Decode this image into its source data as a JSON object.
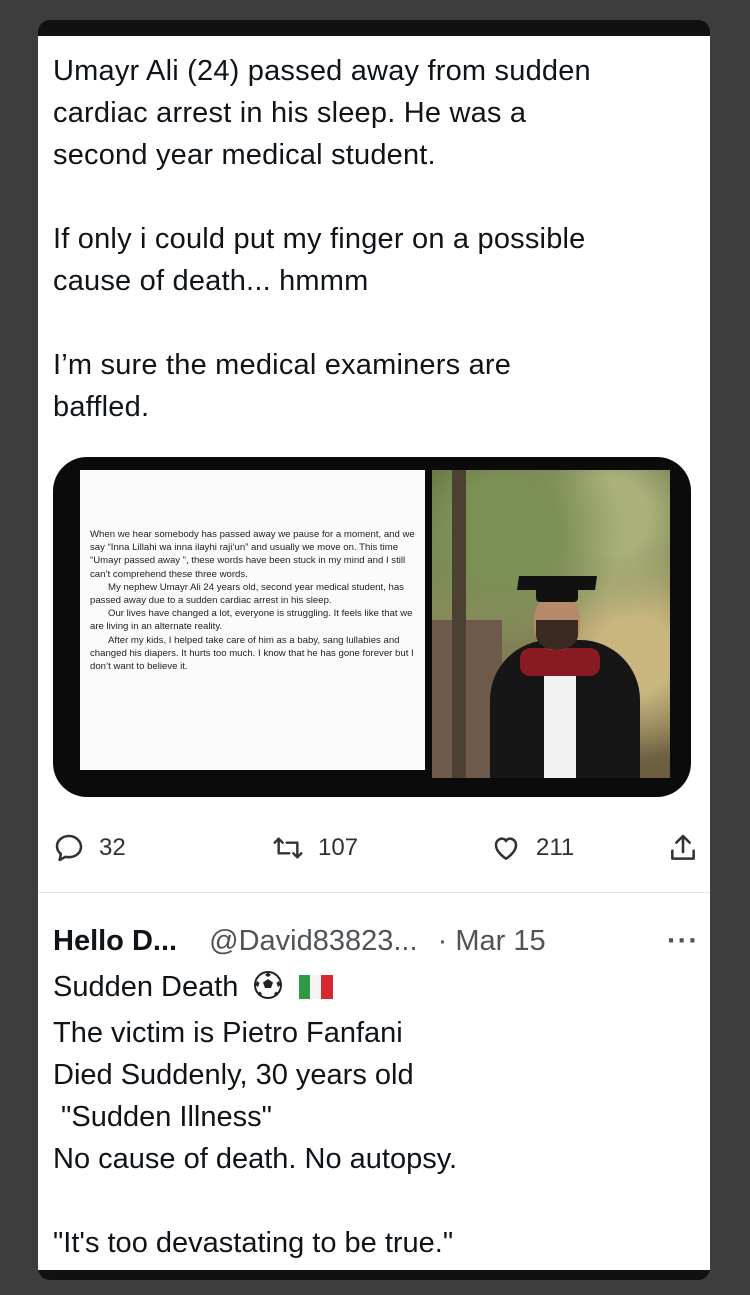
{
  "tweet": {
    "lines": [
      "Umayr Ali (24) passed away from sudden",
      "cardiac arrest in his sleep. He was a",
      "second year medical student.",
      "If only i could put my finger on a possible",
      "cause of death... hmmm",
      "I’m sure the medical examiners are",
      "baffled."
    ]
  },
  "media": {
    "letter": {
      "p1": "When we hear somebody has passed away we pause for a moment, and we say “Inna Lillahi wa inna ilayhi raji’un” and usually we move on. This time “Umayr passed away ”, these words have been stuck in my mind and I still can’t comprehend these three words.",
      "p2": "My nephew Umayr Ali 24 years old, second year medical student, has passed away due to a sudden cardiac arrest in his sleep.",
      "p3": "Our lives have changed a lot, everyone is struggling. It feels like that we are living in an alternate reality.",
      "p4": "After my kids, I helped take care of him as a baby, sang lullabies and changed his diapers. It hurts too much. I know that he has gone forever but I don’t want to believe it."
    }
  },
  "actions": {
    "reply_count": "32",
    "retweet_count": "107",
    "like_count": "211"
  },
  "reply": {
    "name": "Hello D...",
    "handle": "@David83823...",
    "date": "· Mar 15",
    "more": "···",
    "line1": "Sudden Death",
    "line2": "The victim is Pietro Fanfani",
    "line3": "Died Suddenly, 30 years old",
    "line4": " \"Sudden Illness\"",
    "line5": "No cause of death. No autopsy.",
    "line6": "\"It's too devastating to be true.\""
  },
  "colors": {
    "flag_green": "#2e9a48",
    "flag_white": "#f4f4f4",
    "flag_red": "#d42a2f"
  }
}
